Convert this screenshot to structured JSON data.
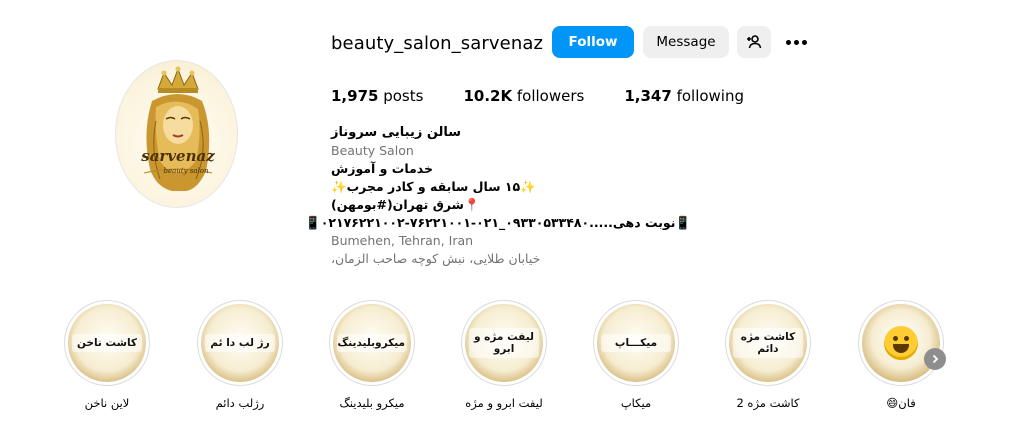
{
  "profile": {
    "username": "beauty_salon_sarvenaz",
    "follow_label": "Follow",
    "message_label": "Message",
    "avatar_text": "sarvenaz",
    "avatar_subtext": "beauty salon",
    "stats": {
      "posts_count": "1,975",
      "posts_label": "posts",
      "followers_count": "10.2K",
      "followers_label": "followers",
      "following_count": "1,347",
      "following_label": "following"
    }
  },
  "bio": {
    "name": "سالن زیبایی سروناز",
    "category": "Beauty Salon",
    "lines": [
      "خدمات و آموزش",
      "✨۱۵ سال سابقه و کادر مجرب✨",
      "📍شرق تهران(#بومهن)",
      "📱نوبت دهی.....۰۹۳۳۰۵۳۳۴۸۰_۰۲۱-۷۶۲۲۱۰۰۱-۰۲۱۷۶۲۲۱۰۰۲📱"
    ],
    "location": "Bumehen, Tehran, Iran",
    "address": "خیابان طلایی، نبش کوچه صاحب الزمان،"
  },
  "highlights": [
    {
      "cover_text": "کاشت ناخن",
      "label": "لاین ناخن"
    },
    {
      "cover_text": "رژ لب دا ئم",
      "label": "رژلب دائم"
    },
    {
      "cover_text": "میکروبلیدینگ",
      "label": "میکرو بلیدینگ"
    },
    {
      "cover_text": "لیفت مژه و ابرو",
      "label": "لیفت ابرو و مژه"
    },
    {
      "cover_text": "میکـــاپ",
      "label": "میکاپ"
    },
    {
      "cover_text": "کاشت مژه دائم",
      "label": "کاشت مژه 2"
    },
    {
      "cover_text": "",
      "label": "فان😄"
    }
  ],
  "colors": {
    "follow_bg": "#0095f6",
    "secondary_btn_bg": "#efefef",
    "muted_text": "#737373",
    "gold": "#c9a24a"
  },
  "icons": {
    "add_user": "add-person-icon",
    "more": "more-options-icon",
    "next": "chevron-right-icon"
  }
}
